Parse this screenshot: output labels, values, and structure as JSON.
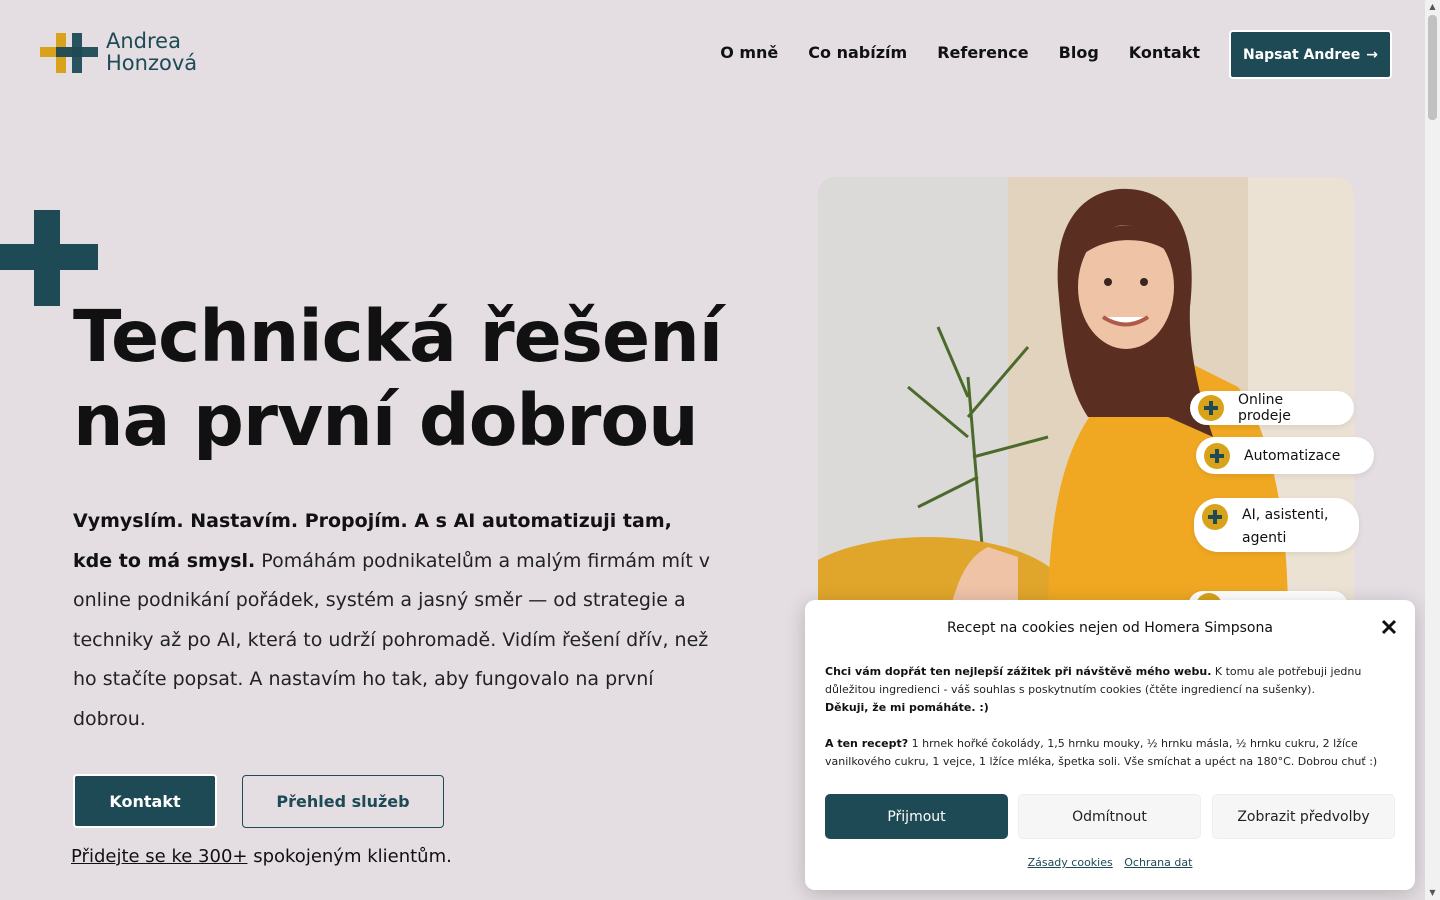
{
  "logo": {
    "line1": "Andrea",
    "line2": "Honzová"
  },
  "nav": {
    "items": [
      "O mně",
      "Co nabízím",
      "Reference",
      "Blog",
      "Kontakt"
    ]
  },
  "header_cta": {
    "label": "Napsat Andree",
    "arrow": "→"
  },
  "hero": {
    "title_line1": "Technická řešení",
    "title_line2": "na první dobrou",
    "body_bold": "Vymyslím. Nastavím. Propojím. A s AI automatizuji tam, kde to má smysl.",
    "body_text": " Pomáhám podnikatelům a malým firmám mít v online podnikání pořádek, systém a jasný směr — od strategie a techniky až po AI, která to udrží pohromadě. Vidím řešení dřív, než ho stačíte popsat. A nastavím ho tak, aby fungovalo na první dobrou.",
    "btn_contact": "Kontakt",
    "btn_services": "Přehled služeb",
    "clients_link": "Přidejte se ke 300+",
    "clients_text": " spokojeným klientům."
  },
  "pills": [
    "Online prodeje",
    "Automatizace",
    "AI, asistenti, agenti"
  ],
  "cookie": {
    "title": "Recept na cookies nejen od Homera Simpsona ",
    "p1_bold": "Chci vám dopřát ten nejlepší zážitek při návštěvě mého webu.",
    "p1_text": " K tomu ale potřebuji jednu důležitou ingredienci - váš souhlas s poskytnutím cookies (čtěte ingrediencí na sušenky).",
    "p2_bold": "Děkuji, že mi pomáháte. :)",
    "p3_bold": "A ten recept?",
    "p3_text": " 1 hrnek hořké čokolády, 1,5 hrnku mouky, ½ hrnku másla, ½ hrnku cukru, 2 lžíce vanilkového cukru, 1 vejce, 1 lžíce mléka, špetka soli. Vše smíchat a upéct na 180°C. Dobrou chuť :)",
    "accept": "Přijmout ",
    "deny": "Odmítnout",
    "prefs": "Zobrazit předvolby",
    "link1": "Zásady cookies",
    "link2": "Ochrana dat"
  },
  "colors": {
    "brand": "#1e4a55",
    "accent": "#d9a21b",
    "background": "#e4dee3"
  },
  "icons": {
    "logo": "plus-logo-icon",
    "arrow": "arrow-right-icon",
    "close": "close-icon"
  }
}
